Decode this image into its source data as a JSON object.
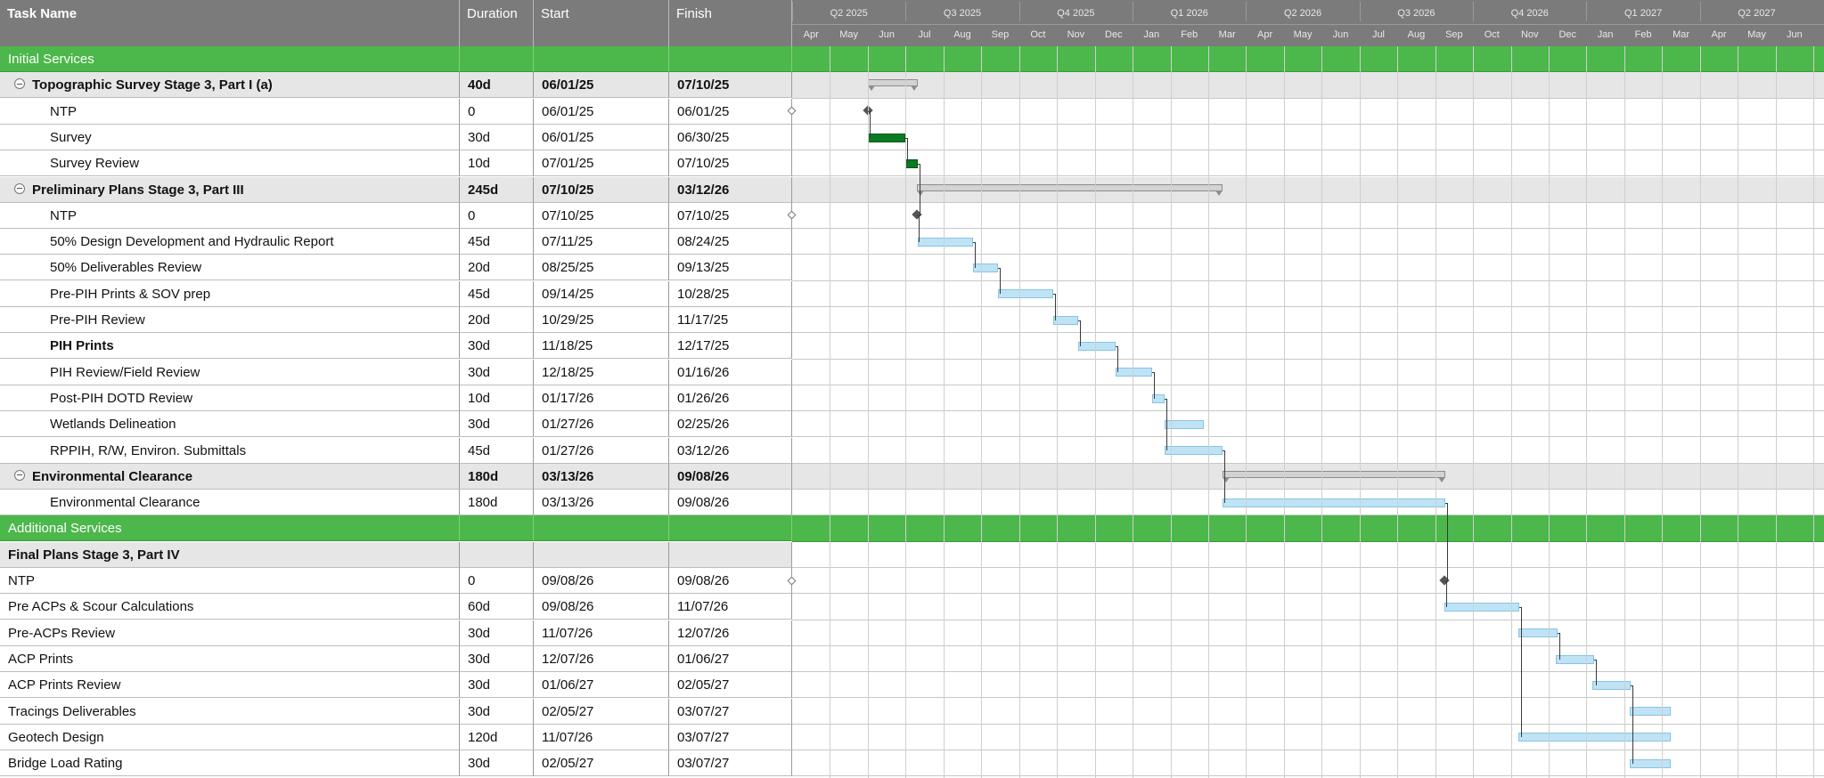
{
  "columns": {
    "task_name": "Task Name",
    "duration": "Duration",
    "start": "Start",
    "finish": "Finish"
  },
  "timeline": {
    "quarters": [
      "Q2 2025",
      "Q3 2025",
      "Q4 2025",
      "Q1 2026",
      "Q2 2026",
      "Q3 2026",
      "Q4 2026",
      "Q1 2027",
      "Q2 2027"
    ],
    "months": [
      "Apr",
      "May",
      "Jun",
      "Jul",
      "Aug",
      "Sep",
      "Oct",
      "Nov",
      "Dec",
      "Jan",
      "Feb",
      "Mar",
      "Apr",
      "May",
      "Jun",
      "Jul",
      "Aug",
      "Sep",
      "Oct",
      "Nov",
      "Dec",
      "Jan",
      "Feb",
      "Mar",
      "Apr",
      "May",
      "Jun"
    ],
    "start_month": "2025-04"
  },
  "colors": {
    "section": "#4cb74a",
    "summary_row": "#e6e6e6",
    "task_bar": "#bfe3f5",
    "completed_bar": "#0b7a22",
    "header": "#7b7b7b"
  },
  "rows": [
    {
      "kind": "section",
      "name": "Initial Services",
      "duration": "",
      "start": "",
      "finish": ""
    },
    {
      "kind": "summary",
      "toggle": true,
      "name": "Topographic Survey Stage 3, Part I (a)",
      "duration": "40d",
      "start": "06/01/25",
      "finish": "07/10/25",
      "bar": "summary",
      "s": "2025-06-01",
      "f": "2025-07-10"
    },
    {
      "kind": "task",
      "indent": true,
      "name": "NTP",
      "duration": "0",
      "start": "06/01/25",
      "finish": "06/01/25",
      "bar": "milestone",
      "s": "2025-06-01",
      "f": "2025-06-01"
    },
    {
      "kind": "task",
      "indent": true,
      "name": "Survey",
      "duration": "30d",
      "start": "06/01/25",
      "finish": "06/30/25",
      "bar": "done",
      "s": "2025-06-01",
      "f": "2025-06-30"
    },
    {
      "kind": "task",
      "indent": true,
      "name": "Survey Review",
      "duration": "10d",
      "start": "07/01/25",
      "finish": "07/10/25",
      "bar": "done",
      "s": "2025-07-01",
      "f": "2025-07-10"
    },
    {
      "kind": "summary",
      "toggle": true,
      "name": "Preliminary Plans Stage 3, Part III",
      "duration": "245d",
      "start": "07/10/25",
      "finish": "03/12/26",
      "bar": "summary",
      "s": "2025-07-10",
      "f": "2026-03-12"
    },
    {
      "kind": "task",
      "indent": true,
      "name": "NTP",
      "duration": "0",
      "start": "07/10/25",
      "finish": "07/10/25",
      "bar": "milestone",
      "s": "2025-07-10",
      "f": "2025-07-10"
    },
    {
      "kind": "task",
      "indent": true,
      "name": "50% Design Development and Hydraulic Report",
      "duration": "45d",
      "start": "07/11/25",
      "finish": "08/24/25",
      "bar": "task",
      "s": "2025-07-11",
      "f": "2025-08-24"
    },
    {
      "kind": "task",
      "indent": true,
      "name": "50% Deliverables Review",
      "duration": "20d",
      "start": "08/25/25",
      "finish": "09/13/25",
      "bar": "task",
      "s": "2025-08-25",
      "f": "2025-09-13"
    },
    {
      "kind": "task",
      "indent": true,
      "name": "Pre-PIH Prints & SOV prep",
      "duration": "45d",
      "start": "09/14/25",
      "finish": "10/28/25",
      "bar": "task",
      "s": "2025-09-14",
      "f": "2025-10-28"
    },
    {
      "kind": "task",
      "indent": true,
      "name": "Pre-PIH Review",
      "duration": "20d",
      "start": "10/29/25",
      "finish": "11/17/25",
      "bar": "task",
      "s": "2025-10-29",
      "f": "2025-11-17"
    },
    {
      "kind": "task",
      "indent": true,
      "bold": true,
      "name": "PIH Prints",
      "duration": "30d",
      "start": "11/18/25",
      "finish": "12/17/25",
      "bar": "task",
      "s": "2025-11-18",
      "f": "2025-12-17"
    },
    {
      "kind": "task",
      "indent": true,
      "name": "PIH Review/Field Review",
      "duration": "30d",
      "start": "12/18/25",
      "finish": "01/16/26",
      "bar": "task",
      "s": "2025-12-18",
      "f": "2026-01-16"
    },
    {
      "kind": "task",
      "indent": true,
      "name": "Post-PIH DOTD Review",
      "duration": "10d",
      "start": "01/17/26",
      "finish": "01/26/26",
      "bar": "task",
      "s": "2026-01-17",
      "f": "2026-01-26"
    },
    {
      "kind": "task",
      "indent": true,
      "name": "Wetlands Delineation",
      "duration": "30d",
      "start": "01/27/26",
      "finish": "02/25/26",
      "bar": "task",
      "s": "2026-01-27",
      "f": "2026-02-25"
    },
    {
      "kind": "task",
      "indent": true,
      "name": "RPPIH, R/W, Environ. Submittals",
      "duration": "45d",
      "start": "01/27/26",
      "finish": "03/12/26",
      "bar": "task",
      "s": "2026-01-27",
      "f": "2026-03-12"
    },
    {
      "kind": "summary",
      "toggle": true,
      "name": "Environmental Clearance",
      "duration": "180d",
      "start": "03/13/26",
      "finish": "09/08/26",
      "bar": "summary",
      "s": "2026-03-13",
      "f": "2026-09-08"
    },
    {
      "kind": "task",
      "indent": true,
      "name": "Environmental Clearance",
      "duration": "180d",
      "start": "03/13/26",
      "finish": "09/08/26",
      "bar": "task",
      "s": "2026-03-13",
      "f": "2026-09-08"
    },
    {
      "kind": "section",
      "name": "Additional Services",
      "duration": "",
      "start": "",
      "finish": ""
    },
    {
      "kind": "group",
      "name": "Final Plans Stage 3, Part IV",
      "duration": "",
      "start": "",
      "finish": ""
    },
    {
      "kind": "task",
      "name": "NTP",
      "duration": "0",
      "start": "09/08/26",
      "finish": "09/08/26",
      "bar": "milestone",
      "s": "2026-09-08",
      "f": "2026-09-08"
    },
    {
      "kind": "task",
      "name": "Pre ACPs & Scour Calculations",
      "duration": "60d",
      "start": "09/08/26",
      "finish": "11/07/26",
      "bar": "task",
      "s": "2026-09-08",
      "f": "2026-11-07"
    },
    {
      "kind": "task",
      "name": "Pre-ACPs Review",
      "duration": "30d",
      "start": "11/07/26",
      "finish": "12/07/26",
      "bar": "task",
      "s": "2026-11-07",
      "f": "2026-12-07"
    },
    {
      "kind": "task",
      "name": "ACP Prints",
      "duration": "30d",
      "start": "12/07/26",
      "finish": "01/06/27",
      "bar": "task",
      "s": "2026-12-07",
      "f": "2027-01-06"
    },
    {
      "kind": "task",
      "name": "ACP Prints Review",
      "duration": "30d",
      "start": "01/06/27",
      "finish": "02/05/27",
      "bar": "task",
      "s": "2027-01-06",
      "f": "2027-02-05"
    },
    {
      "kind": "task",
      "name": "Tracings Deliverables",
      "duration": "30d",
      "start": "02/05/27",
      "finish": "03/07/27",
      "bar": "task",
      "s": "2027-02-05",
      "f": "2027-03-07"
    },
    {
      "kind": "task",
      "name": "Geotech Design",
      "duration": "120d",
      "start": "11/07/26",
      "finish": "03/07/27",
      "bar": "task",
      "s": "2026-11-07",
      "f": "2027-03-07"
    },
    {
      "kind": "task",
      "name": "Bridge Load Rating",
      "duration": "30d",
      "start": "02/05/27",
      "finish": "03/07/27",
      "bar": "task",
      "s": "2027-02-05",
      "f": "2027-03-07"
    }
  ]
}
